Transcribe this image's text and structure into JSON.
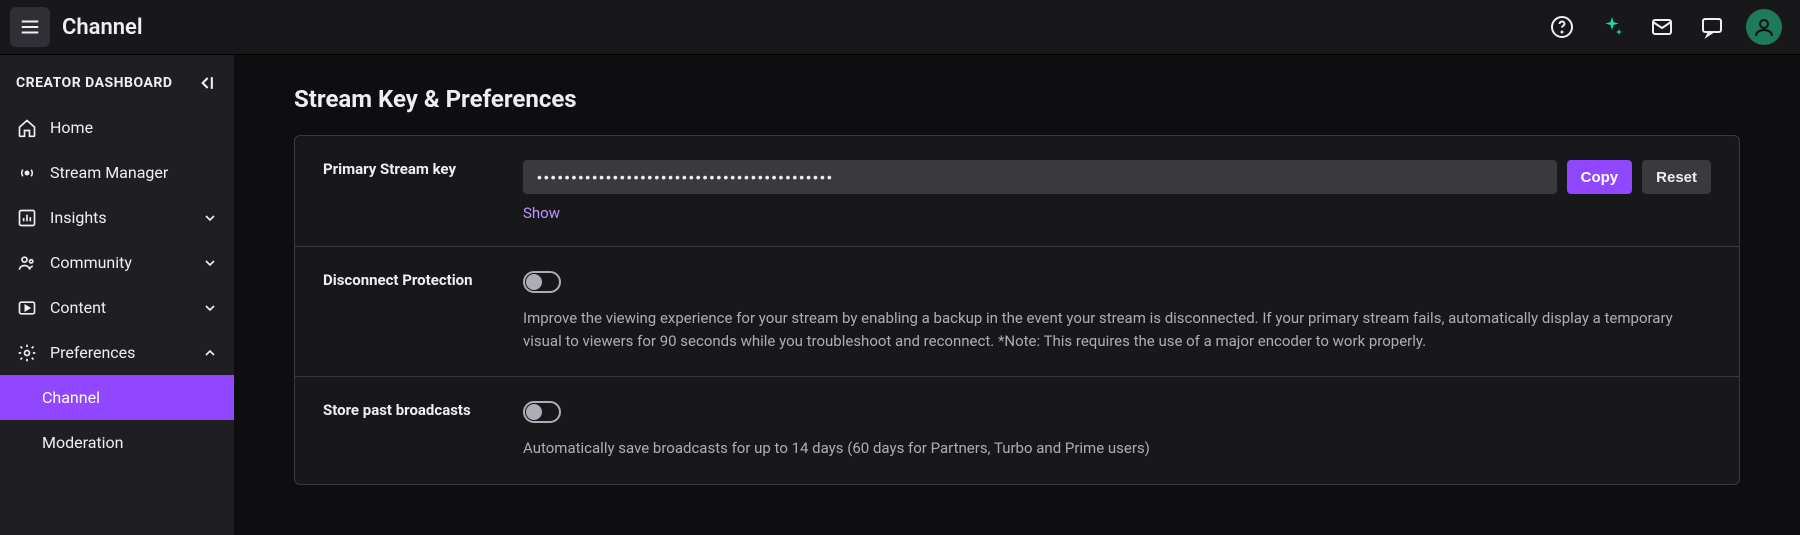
{
  "topbar": {
    "title": "Channel"
  },
  "sidebar": {
    "header": "CREATOR DASHBOARD",
    "items": {
      "home": "Home",
      "stream_manager": "Stream Manager",
      "insights": "Insights",
      "community": "Community",
      "content": "Content",
      "preferences": "Preferences",
      "channel": "Channel",
      "moderation": "Moderation"
    }
  },
  "page": {
    "title": "Stream Key & Preferences"
  },
  "stream_key": {
    "label": "Primary Stream key",
    "masked": "•••••••••••••••••••••••••••••••••••••••••••",
    "copy": "Copy",
    "reset": "Reset",
    "show": "Show"
  },
  "disconnect": {
    "label": "Disconnect Protection",
    "desc": "Improve the viewing experience for your stream by enabling a backup in the event your stream is disconnected. If your primary stream fails, automatically display a temporary visual to viewers for 90 seconds while you troubleshoot and reconnect. *Note: This requires the use of a major encoder to work properly."
  },
  "store": {
    "label": "Store past broadcasts",
    "desc": "Automatically save broadcasts for up to 14 days (60 days for Partners, Turbo and Prime users)"
  }
}
